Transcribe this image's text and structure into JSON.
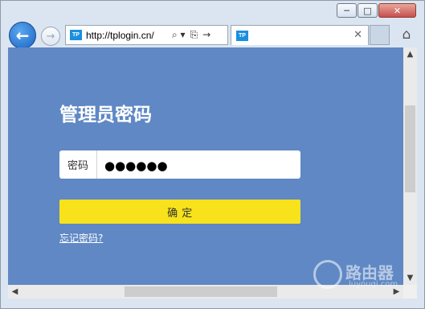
{
  "browser": {
    "window_controls": {
      "minimize": "─",
      "maximize": "□",
      "close": "✕"
    },
    "nav": {
      "back_icon": "←",
      "forward_icon": "→"
    },
    "address_bar": {
      "favicon_text": "TP",
      "url": "http://tplogin.cn/",
      "search_icon": "⌕ ▾",
      "compat_icon": "⎘",
      "go_icon": "→"
    },
    "tab": {
      "favicon_text": "TP",
      "close_icon": "✕"
    },
    "home_icon": "⌂"
  },
  "page": {
    "background_color": "#5f88c4",
    "title": "管理员密码",
    "password_label": "密码",
    "password_value": "●●●●●●",
    "confirm_label": "确   定",
    "confirm_color": "#f7e21b",
    "forgot_link": "忘记密码?"
  },
  "scrollbars": {
    "up": "▲",
    "down": "▼",
    "left": "◀",
    "right": "▶"
  },
  "watermark": {
    "name": "路由器",
    "domain": "luyouqi.com"
  }
}
